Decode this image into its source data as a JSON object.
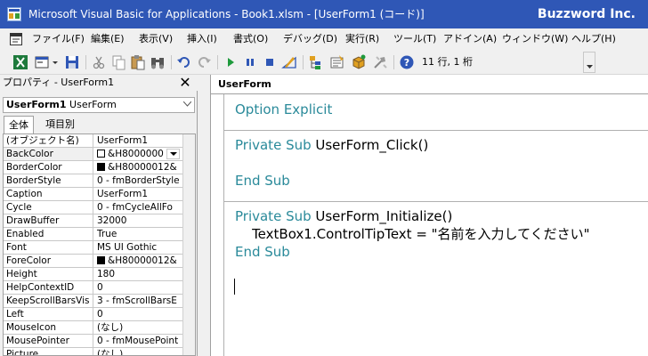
{
  "titlebar": {
    "title": "Microsoft Visual Basic for Applications - Book1.xlsm - [UserForm1 (コード)]",
    "brand": "Buzzword Inc.",
    "bg_color": "#2f57b6"
  },
  "menu": [
    {
      "label": "ファイル(F)"
    },
    {
      "label": "編集(E)"
    },
    {
      "label": "表示(V)"
    },
    {
      "label": "挿入(I)"
    },
    {
      "label": "書式(O)"
    },
    {
      "label": "デバッグ(D)"
    },
    {
      "label": "実行(R)"
    },
    {
      "label": "ツール(T)"
    },
    {
      "label": "アドイン(A)"
    },
    {
      "label": "ウィンドウ(W)"
    },
    {
      "label": "ヘルプ(H)"
    }
  ],
  "toolbar": {
    "icons": [
      "excel-icon",
      "insert-userform-icon",
      "save-icon",
      "cut-icon",
      "copy-icon",
      "paste-icon",
      "find-icon",
      "undo-icon",
      "redo-icon",
      "run-icon",
      "break-icon",
      "reset-icon",
      "design-mode-icon",
      "project-explorer-icon",
      "properties-icon",
      "object-browser-icon",
      "toolbox-icon",
      "help-icon"
    ],
    "cursor_position": "11 行, 1 桁"
  },
  "properties": {
    "header": "プロパティ - UserForm1",
    "object_name": "UserForm1",
    "object_type": "UserForm",
    "tabs": [
      {
        "label": "全体"
      },
      {
        "label": "項目別"
      }
    ],
    "rows": [
      {
        "name": "(オブジェクト名)",
        "value": "UserForm1"
      },
      {
        "name": "BackColor",
        "value": "&H8000000",
        "swatch": "#ffffff"
      },
      {
        "name": "BorderColor",
        "value": "&H80000012&",
        "swatch": "#000000"
      },
      {
        "name": "BorderStyle",
        "value": "0 - fmBorderStyle"
      },
      {
        "name": "Caption",
        "value": "UserForm1"
      },
      {
        "name": "Cycle",
        "value": "0 - fmCycleAllFo"
      },
      {
        "name": "DrawBuffer",
        "value": "32000"
      },
      {
        "name": "Enabled",
        "value": "True"
      },
      {
        "name": "Font",
        "value": "MS UI Gothic"
      },
      {
        "name": "ForeColor",
        "value": "&H80000012&",
        "swatch": "#000000"
      },
      {
        "name": "Height",
        "value": "180"
      },
      {
        "name": "HelpContextID",
        "value": "0"
      },
      {
        "name": "KeepScrollBarsVis",
        "value": "3 - fmScrollBarsE"
      },
      {
        "name": "Left",
        "value": "0"
      },
      {
        "name": "MouseIcon",
        "value": "(なし)"
      },
      {
        "name": "MousePointer",
        "value": "0 - fmMousePoint"
      },
      {
        "name": "Picture",
        "value": "(なし)"
      }
    ]
  },
  "code_window": {
    "object_box": "UserForm",
    "keyword_color": "#2a8a9a",
    "lines": [
      {
        "kw": "Option Explicit",
        "text": ""
      },
      {
        "kw": "Private Sub",
        "text": " UserForm_Click()"
      },
      {
        "kw": "End Sub",
        "text": ""
      },
      {
        "kw": "Private Sub",
        "text": " UserForm_Initialize()"
      },
      {
        "kw": "",
        "text": "    TextBox1.ControlTipText = \"名前を入力してください\""
      },
      {
        "kw": "End Sub",
        "text": ""
      }
    ]
  }
}
